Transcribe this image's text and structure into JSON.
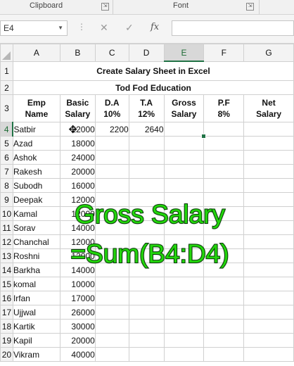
{
  "ribbon": {
    "clipboard_label": "Clipboard",
    "font_label": "Font",
    "launcher_glyph": "⇲"
  },
  "formula_bar": {
    "name_box": "E4",
    "name_dropdown_glyph": "▼",
    "cancel_glyph": "✕",
    "enter_glyph": "✓",
    "fx_label": "fx",
    "formula": ""
  },
  "columns": [
    "A",
    "B",
    "C",
    "D",
    "E",
    "F",
    "G"
  ],
  "rows": [
    "1",
    "2",
    "3",
    "4",
    "5",
    "6",
    "7",
    "8",
    "9",
    "10",
    "11",
    "12",
    "13",
    "14",
    "15",
    "16",
    "17",
    "18",
    "19",
    "20"
  ],
  "sheet": {
    "title": "Create Salary Sheet in Excel",
    "subtitle": "Tod Fod Education",
    "headers": [
      [
        "Emp",
        "Name"
      ],
      [
        "Basic",
        "Salary"
      ],
      [
        "D.A",
        "10%"
      ],
      [
        "T.A",
        "12%"
      ],
      [
        "Gross",
        "Salary"
      ],
      [
        "P.F",
        "8%"
      ],
      [
        "Net",
        "Salary"
      ]
    ],
    "employees": [
      {
        "name": "Satbir",
        "basic": "22000",
        "da": "2200",
        "ta": "2640"
      },
      {
        "name": "Azad",
        "basic": "18000"
      },
      {
        "name": "Ashok",
        "basic": "24000"
      },
      {
        "name": "Rakesh",
        "basic": "20000"
      },
      {
        "name": "Subodh",
        "basic": "16000"
      },
      {
        "name": "Deepak",
        "basic": "12000"
      },
      {
        "name": "Kamal",
        "basic": "12000"
      },
      {
        "name": "Sorav",
        "basic": "14000"
      },
      {
        "name": "Chanchal",
        "basic": "12000"
      },
      {
        "name": "Roshni",
        "basic": "12000"
      },
      {
        "name": "Barkha",
        "basic": "14000"
      },
      {
        "name": "komal",
        "basic": "10000"
      },
      {
        "name": "Irfan",
        "basic": "17000"
      },
      {
        "name": "Ujjwal",
        "basic": "26000"
      },
      {
        "name": "Kartik",
        "basic": "30000"
      },
      {
        "name": "Kapil",
        "basic": "20000"
      },
      {
        "name": "Vikram",
        "basic": "40000"
      }
    ]
  },
  "overlay": {
    "line1": "Gross Salary",
    "line2": "=Sum(B4:D4)"
  },
  "colors": {
    "excel_green": "#217346",
    "overlay_text": "#22d60b",
    "overlay_stroke": "#073a07"
  }
}
